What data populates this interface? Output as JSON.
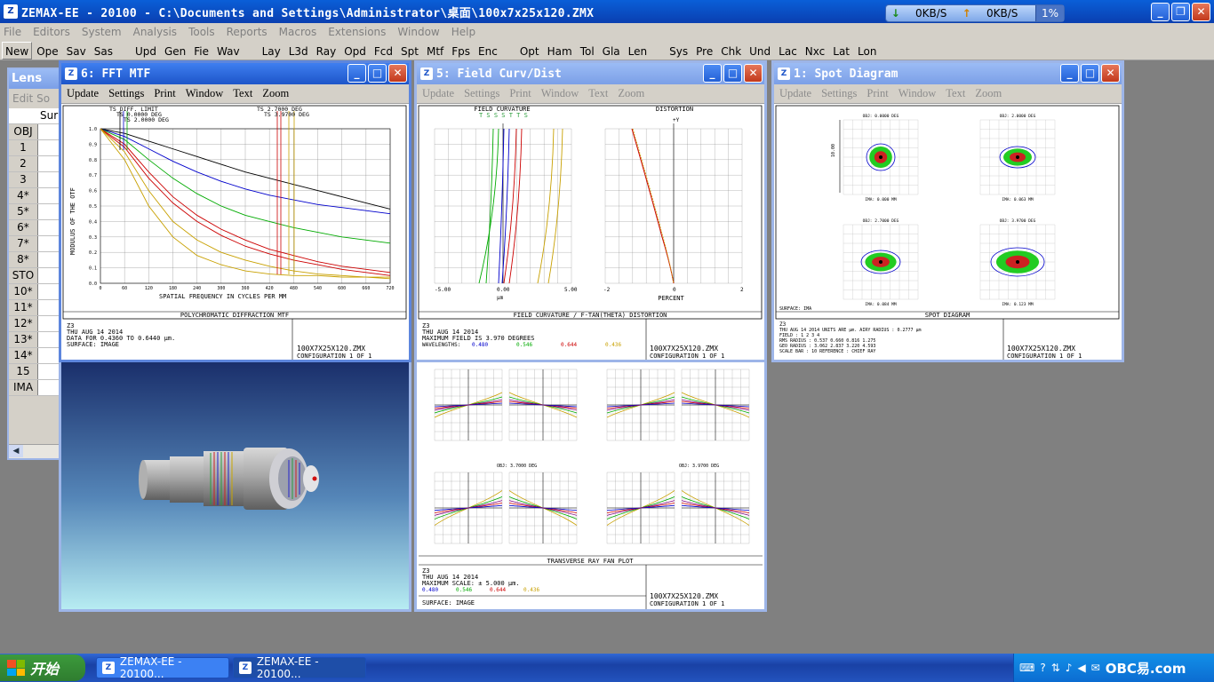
{
  "app": {
    "title": "ZEMAX-EE - 20100 - C:\\Documents and Settings\\Administrator\\桌面\\100x7x25x120.ZMX",
    "icon": "zemax-icon",
    "net_down": "0KB/S",
    "net_up": "0KB/S",
    "net_pct": "1%"
  },
  "menu": [
    "File",
    "Editors",
    "System",
    "Analysis",
    "Tools",
    "Reports",
    "Macros",
    "Extensions",
    "Window",
    "Help"
  ],
  "toolbar": [
    "New",
    "Ope",
    "Sav",
    "Sas",
    "Upd",
    "Gen",
    "Fie",
    "Wav",
    "Lay",
    "L3d",
    "Ray",
    "Opd",
    "Fcd",
    "Spt",
    "Mtf",
    "Fps",
    "Enc",
    "Opt",
    "Ham",
    "Tol",
    "Gla",
    "Len",
    "Sys",
    "Pre",
    "Chk",
    "Und",
    "Lac",
    "Nxc",
    "Lat",
    "Lon"
  ],
  "lens_editor": {
    "title": "Lens",
    "menu": [
      "Edit",
      "So"
    ],
    "header": "Sur",
    "rows": [
      "OBJ",
      "1",
      "2",
      "3",
      "4*",
      "5*",
      "6*",
      "7*",
      "8*",
      "STO",
      "10*",
      "11*",
      "12*",
      "13*",
      "14*",
      "15",
      "IMA"
    ]
  },
  "mtf": {
    "title": "6: FFT MTF",
    "menu": [
      "Update",
      "Settings",
      "Print",
      "Window",
      "Text",
      "Zoom"
    ],
    "legend": [
      "TS DIFF. LIMIT",
      "TS 0.0000 DEG",
      "TS 2.0000 DEG",
      "TS 2.7000 DEG",
      "TS 3.9700 DEG"
    ],
    "ylabel": "MODULUS OF THE OTF",
    "xlabel": "SPATIAL FREQUENCY IN CYCLES PER MM",
    "yticks": [
      "1.0",
      "0.9",
      "0.8",
      "0.7",
      "0.6",
      "0.5",
      "0.4",
      "0.3",
      "0.2",
      "0.1",
      "0.0"
    ],
    "xticks": [
      "0",
      "60",
      "120",
      "180",
      "240",
      "300",
      "360",
      "420",
      "480",
      "540",
      "600",
      "660",
      "720"
    ],
    "caption": "POLYCHROMATIC DIFFRACTION MTF",
    "info": [
      "Z3",
      "THU AUG 14 2014",
      "DATA FOR 0.4360 TO 0.6440 µm.",
      "SURFACE: IMAGE"
    ],
    "file": "100X7X25X120.ZMX",
    "config": "CONFIGURATION 1 OF 1"
  },
  "field": {
    "title": "5: Field Curv/Dist",
    "menu": [
      "Update",
      "Settings",
      "Print",
      "Window",
      "Text",
      "Zoom"
    ],
    "left_title": "FIELD CURVATURE",
    "left_legend": "T S S S T T S",
    "right_title": "DISTORTION",
    "left_xticks": [
      "-5.00",
      "0.00",
      "5.00"
    ],
    "left_unit": "µm",
    "right_xticks": [
      "-2",
      "0",
      "2"
    ],
    "right_unit": "PERCENT",
    "yaxis": "+Y",
    "caption": "FIELD CURVATURE / F-TAN(THETA) DISTORTION",
    "info": [
      "Z3",
      "THU AUG 14 2014",
      "MAXIMUM FIELD IS 3.970 DEGREES"
    ],
    "wavelengths_label": "WAVELENGTHS:",
    "wavelengths": [
      "0.480",
      "0.546",
      "0.644",
      "0.436"
    ],
    "file": "100X7X25X120.ZMX",
    "config": "CONFIGURATION 1 OF 1"
  },
  "spot": {
    "title": "1: Spot Diagram",
    "menu": [
      "Update",
      "Settings",
      "Print",
      "Window",
      "Text",
      "Zoom"
    ],
    "cells": [
      {
        "obj": "OBJ: 0.0000 DEG",
        "ima": "IMA: 0.000 MM"
      },
      {
        "obj": "OBJ: 2.0000 DEG",
        "ima": "IMA: 0.063 MM"
      },
      {
        "obj": "OBJ: 2.7000 DEG",
        "ima": "IMA: 0.084 MM"
      },
      {
        "obj": "OBJ: 3.9700 DEG",
        "ima": "IMA: 0.123 MM"
      }
    ],
    "scale_label": "10.00",
    "surface": "SURFACE: IMA",
    "caption": "SPOT DIAGRAM",
    "info": [
      "Z3",
      "THU AUG 14 2014   UNITS ARE µm.   AIRY RADIUS : 0.2777 µm",
      "FIELD      :      1         2         3         4",
      "RMS RADIUS :   0.537     0.660     0.816     1.275",
      "GEO RADIUS :   3.062     2.837     3.220     4.593",
      "SCALE BAR  :   10        REFERENCE  : CHIEF RAY"
    ],
    "file": "100X7X25X120.ZMX",
    "config": "CONFIGURATION 1 OF 1"
  },
  "rayfan": {
    "caption": "TRANSVERSE RAY FAN PLOT",
    "info": [
      "Z3",
      "THU AUG 14 2014",
      "MAXIMUM SCALE: ± 5.000 µm."
    ],
    "wavelengths": [
      "0.480",
      "0.546",
      "0.644",
      "0.436"
    ],
    "surface": "SURFACE: IMAGE",
    "field_labels": [
      "OBJ: 3.7000 DEG",
      "OBJ: 3.9700 DEG"
    ],
    "file": "100X7X25X120.ZMX",
    "config": "CONFIGURATION 1 OF 1"
  },
  "taskbar": {
    "start": "开始",
    "tasks": [
      "ZEMAX-EE - 20100...",
      "ZEMAX-EE - 20100..."
    ],
    "tray_text": "OBC易.com"
  },
  "colors": {
    "titlebar": "#1d55c9",
    "desktop": "#808080",
    "chrome": "#d4d0c8",
    "blue_wl": "#0000cc",
    "green_wl": "#00cc00",
    "red_wl": "#cc0000",
    "yellow_wl": "#c8a000"
  }
}
